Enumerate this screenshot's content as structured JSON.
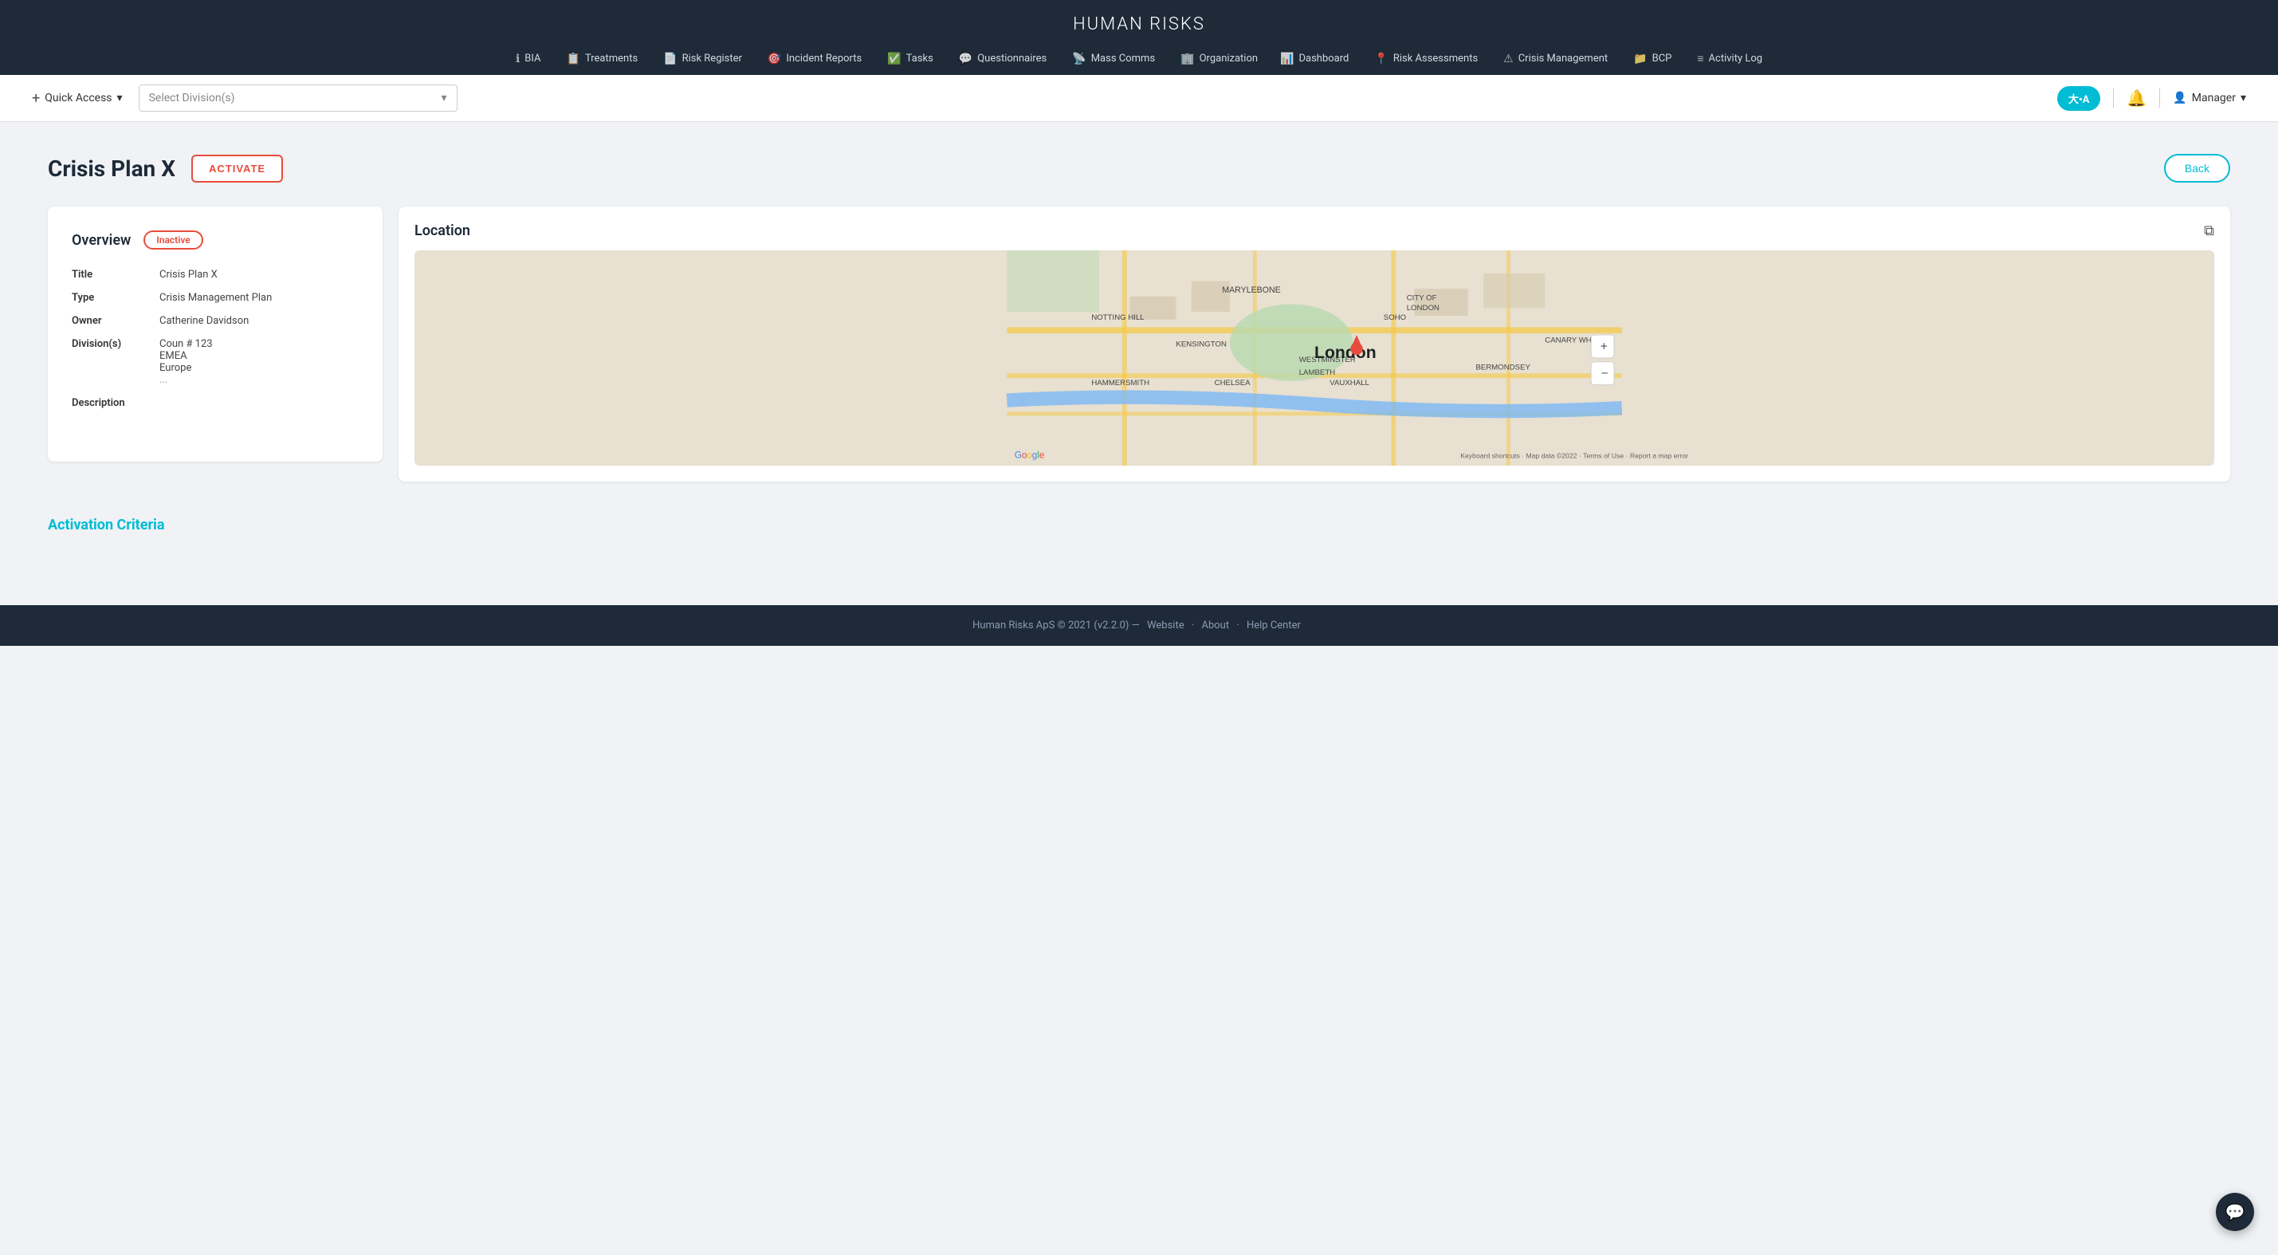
{
  "app": {
    "logo": "HUMAN RISKS"
  },
  "nav": {
    "row1": [
      {
        "label": "BIA",
        "icon": "ℹ"
      },
      {
        "label": "Treatments",
        "icon": "📋"
      },
      {
        "label": "Risk Register",
        "icon": "📄"
      },
      {
        "label": "Incident Reports",
        "icon": "🎯"
      },
      {
        "label": "Tasks",
        "icon": "✅"
      },
      {
        "label": "Questionnaires",
        "icon": "💬"
      },
      {
        "label": "Mass Comms",
        "icon": "📡"
      },
      {
        "label": "Organization",
        "icon": "🏢"
      }
    ],
    "row2": [
      {
        "label": "Dashboard",
        "icon": "📊"
      },
      {
        "label": "Risk Assessments",
        "icon": "📍"
      },
      {
        "label": "Crisis Management",
        "icon": "⚠"
      },
      {
        "label": "BCP",
        "icon": "📁"
      },
      {
        "label": "Activity Log",
        "icon": "≡"
      }
    ]
  },
  "toolbar": {
    "quick_access_label": "Quick Access",
    "division_placeholder": "Select Division(s)",
    "translate_label": "大•A",
    "user_label": "Manager"
  },
  "page": {
    "title": "Crisis Plan X",
    "activate_label": "ACTIVATE",
    "back_label": "Back"
  },
  "overview": {
    "card_title": "Overview",
    "badge_label": "Inactive",
    "fields": [
      {
        "label": "Title",
        "value": "Crisis Plan X"
      },
      {
        "label": "Type",
        "value": "Crisis Management Plan"
      },
      {
        "label": "Owner",
        "value": "Catherine Davidson"
      },
      {
        "label": "Division(s)",
        "value": [
          "Coun # 123",
          "EMEA",
          "Europe",
          "..."
        ]
      },
      {
        "label": "Description",
        "value": ""
      }
    ]
  },
  "location": {
    "card_title": "Location",
    "map_center": "London",
    "map_credit": "Google",
    "map_data_label": "Map data ©2022",
    "keyboard_shortcuts": "Keyboard shortcuts",
    "terms": "Terms of Use",
    "report": "Report a map error"
  },
  "activation_criteria": {
    "section_title": "Activation Criteria"
  },
  "footer": {
    "copyright": "Human Risks ApS © 2021 (v2.2.0)",
    "separator": "—",
    "links": [
      "Website",
      "About",
      "Help Center"
    ]
  },
  "chat": {
    "icon": "💬"
  }
}
